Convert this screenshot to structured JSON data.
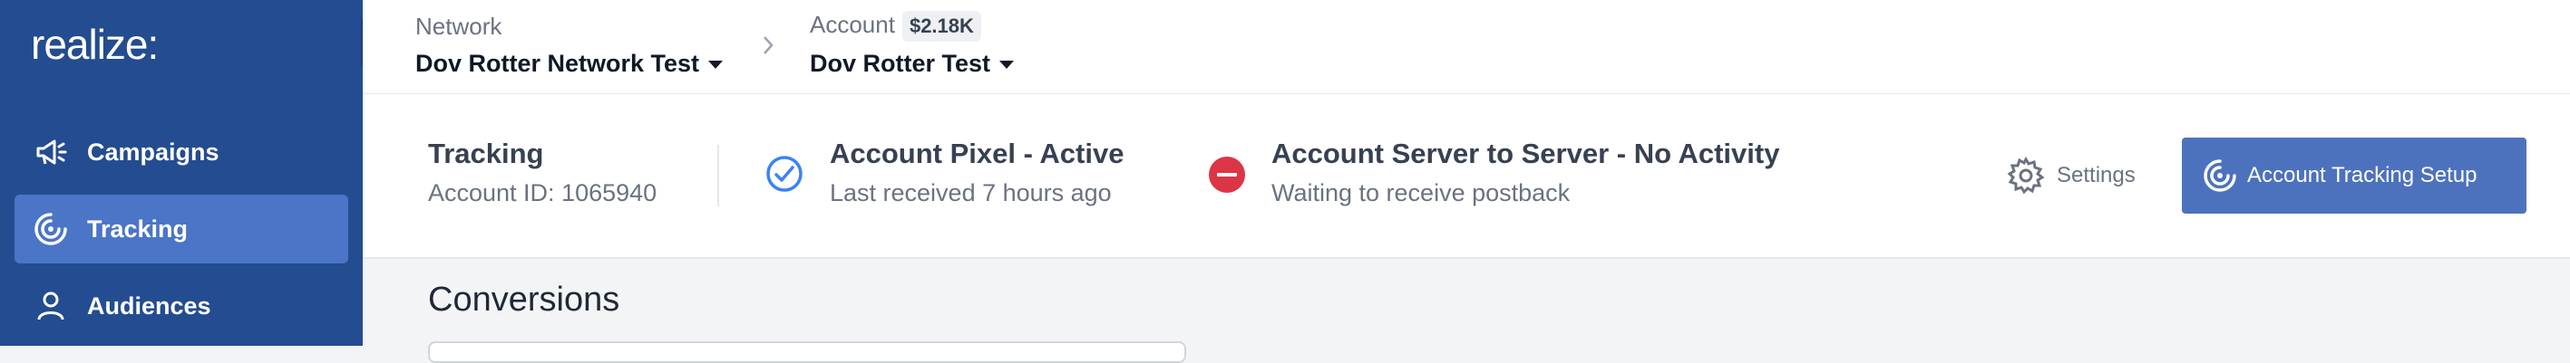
{
  "sidebar": {
    "logo": "realize:",
    "items": [
      {
        "label": "Campaigns",
        "icon": "megaphone-icon",
        "active": false
      },
      {
        "label": "Tracking",
        "icon": "tracking-icon",
        "active": true
      },
      {
        "label": "Audiences",
        "icon": "user-icon",
        "active": false
      }
    ]
  },
  "header": {
    "network_label": "Network",
    "network_value": "Dov Rotter Network Test",
    "account_label": "Account",
    "account_badge": "$2.18K",
    "account_value": "Dov Rotter Test"
  },
  "tracking": {
    "title": "Tracking",
    "account_id": "Account ID: 1065940",
    "pixel_status": "Account Pixel - Active",
    "pixel_sub": "Last received 7 hours ago",
    "s2s_status": "Account Server to Server - No Activity",
    "s2s_sub": "Waiting to receive postback",
    "settings_label": "Settings",
    "setup_button": "Account Tracking Setup"
  },
  "section": {
    "title": "Conversions"
  },
  "colors": {
    "sidebar": "#244c90",
    "active": "#4b75c7",
    "primary_button": "#4d72bd",
    "success": "#3b82f6",
    "error": "#dc3545"
  }
}
